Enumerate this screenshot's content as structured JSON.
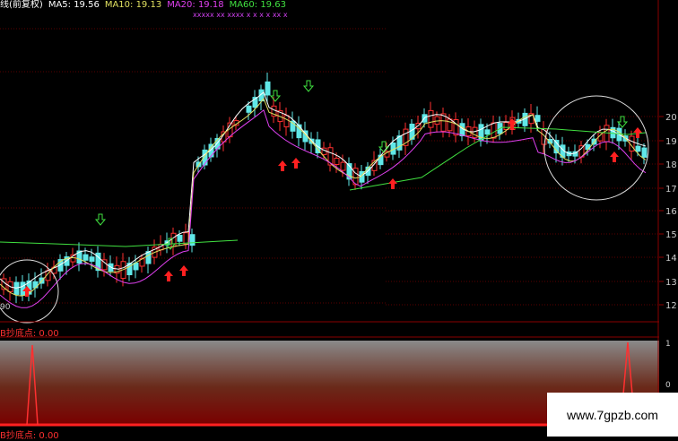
{
  "header": {
    "title": "线(前复权)",
    "ma5": "MA5: 19.56",
    "ma10": "MA10: 19.13",
    "ma20": "MA20: 19.18",
    "ma60": "MA60: 19.63",
    "marker_row": "xxxxx xx   xxxx  x  x  x   x       xx  x",
    "colors": {
      "title": "#ffffff",
      "ma5": "#ffffff",
      "ma10": "#e0e060",
      "ma20": "#e040f0",
      "ma60": "#40e040"
    }
  },
  "yaxis": {
    "labels": [
      "20",
      "19",
      "18",
      "17",
      "16",
      "15",
      "14",
      "13",
      "12"
    ]
  },
  "left_label": "90",
  "indicator": {
    "label": "B抄底点: 0.00",
    "axis_labels": [
      "1",
      "0"
    ],
    "bottom_label": "B抄底点: 0.00"
  },
  "watermark": "www.7gpzb.com"
}
